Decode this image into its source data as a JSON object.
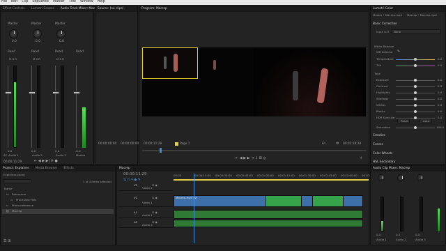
{
  "menu": [
    "File",
    "Edit",
    "Clip",
    "Sequence",
    "Marker",
    "Title",
    "Window",
    "Help"
  ],
  "top_left_tabs": [
    "Effect Controls",
    "Lumetri Scopes",
    "Audio Track Mixer: Macrep"
  ],
  "mixer": {
    "channels": [
      {
        "read": "Read",
        "value": "0.0",
        "name": "A1",
        "bottom": "Audio 1"
      },
      {
        "read": "Read",
        "value": "0.0",
        "name": "A2",
        "bottom": "Audio 2"
      },
      {
        "read": "Read",
        "value": "0.0",
        "name": "A3",
        "bottom": "Audio 3"
      },
      {
        "read": "Read",
        "value": "-0.0",
        "name": "M",
        "bottom": "Master"
      }
    ],
    "master_label": "Master",
    "time": "00:00:11:29"
  },
  "source": {
    "title": "Source: (no clips)",
    "tc_left": "00:00:00:00",
    "tc_right": "00:00:00:00"
  },
  "program": {
    "title": "Program: Macrep",
    "timecode": "00:00:11:29",
    "fit": "Fit",
    "page": "Page 1",
    "duration": "00:02:18:28"
  },
  "lumetri": {
    "title": "Lumetri Color",
    "breadcrumb": "Master * Macrep.mp4",
    "breadcrumb2": "Macrep * Macrep.mp4",
    "basic": "Basic Correction",
    "input_lut_label": "Input LUT",
    "input_lut_value": "None",
    "white_balance": "White Balance",
    "wb_selector": "WB Selector",
    "rows": [
      {
        "name": "Temperature",
        "value": "0.0"
      },
      {
        "name": "Tint",
        "value": "0.0"
      }
    ],
    "tone": "Tone",
    "tone_rows": [
      {
        "name": "Exposure",
        "value": "0.0"
      },
      {
        "name": "Contrast",
        "value": "0.0"
      },
      {
        "name": "Highlights",
        "value": "0.0"
      },
      {
        "name": "Shadows",
        "value": "0.0"
      },
      {
        "name": "Whites",
        "value": "0.0"
      },
      {
        "name": "Blacks",
        "value": "0.0"
      },
      {
        "name": "HDR Specular",
        "value": "0.0"
      }
    ],
    "reset": "Reset",
    "auto": "Auto",
    "saturation_label": "Saturation",
    "saturation_value": "100.0",
    "sections": [
      "Creative",
      "Curves",
      "Color Wheels",
      "HSL Secondary",
      "Vignette"
    ]
  },
  "project": {
    "tabs": [
      "Project: Explainer",
      "Media Browser",
      "Effects"
    ],
    "file": "Explainer.prproj",
    "count": "1 of 4 items selected",
    "name_header": "Name",
    "items": [
      {
        "name": "Rotoscene",
        "type": "folder"
      },
      {
        "name": "Processed Files",
        "type": "folder"
      },
      {
        "name": "Photo reference",
        "type": "file"
      },
      {
        "name": "Macrep",
        "type": "sequence"
      }
    ]
  },
  "timeline": {
    "tab": "Macrep",
    "timecode": "00:00:11:29",
    "ruler": [
      "00:00",
      "00:00:15:00",
      "00:00:30:00",
      "00:00:45:00",
      "00:01:00:00",
      "00:01:15:00",
      "00:01:30:00",
      "00:01:45:00",
      "00:02:00:00",
      "00:02:15:00"
    ],
    "tracks": [
      {
        "id": "V2",
        "name": "Video 2"
      },
      {
        "id": "V1",
        "name": "Video 1"
      },
      {
        "id": "A1",
        "name": "Audio 1"
      },
      {
        "id": "A2",
        "name": "Audio 2"
      }
    ],
    "clip_label": "Macrep.mp4 [V]"
  },
  "audio_clip_mixer": {
    "title": "Audio Clip Mixer: Macrep",
    "channels": [
      {
        "value": "0.0",
        "name": "Audio 1"
      },
      {
        "value": "0.0",
        "name": "Audio 2"
      },
      {
        "value": "0.0",
        "name": "Audio 3"
      }
    ]
  },
  "colors": {
    "accent": "#3f8fe0",
    "green": "#3bb23b",
    "yellow": "#e5d04c",
    "clip_blue": "#3d6fa8",
    "clip_green": "#36a24a"
  }
}
